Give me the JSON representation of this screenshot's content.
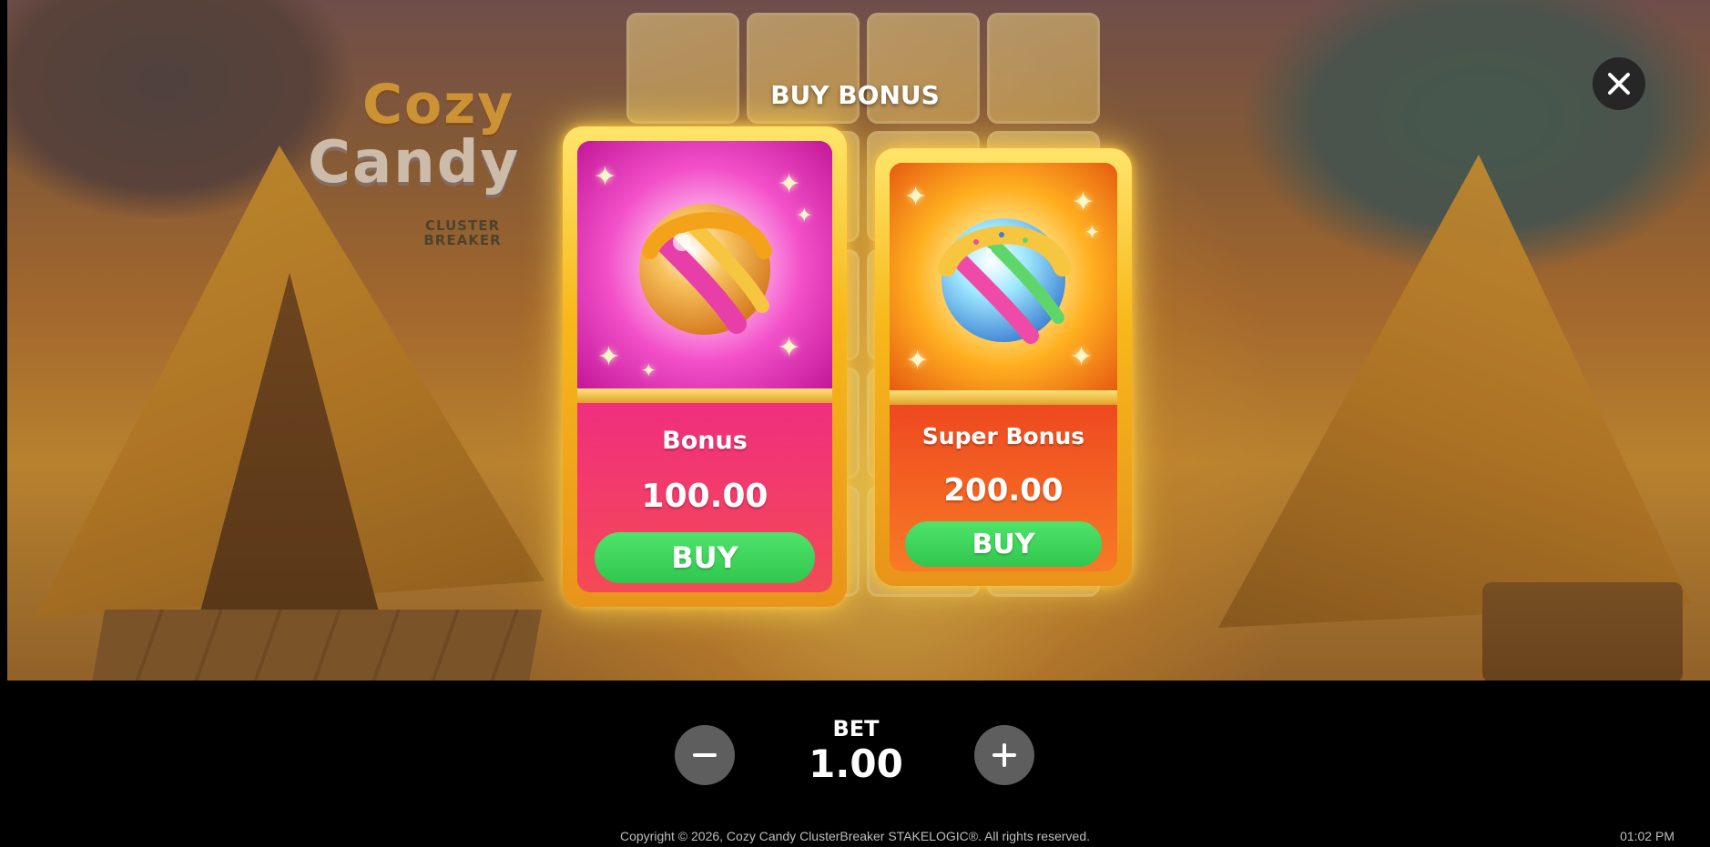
{
  "game": {
    "logo_line1": "Cozy",
    "logo_line2": "Candy",
    "logo_subtitle": "CLUSTER BREAKER"
  },
  "modal": {
    "title": "BUY BONUS",
    "close_icon": "close-icon",
    "cards": [
      {
        "name": "Bonus",
        "price": "100.00",
        "button_label": "BUY",
        "accent": "#e8217f",
        "art_icon": "candy-ball-icon"
      },
      {
        "name": "Super Bonus",
        "price": "200.00",
        "button_label": "BUY",
        "accent": "#e8301a",
        "art_icon": "super-candy-ball-icon"
      }
    ]
  },
  "bet": {
    "label": "BET",
    "value": "1.00",
    "decrease_icon": "minus-icon",
    "increase_icon": "plus-icon"
  },
  "footer": {
    "copyright": "Copyright © 2026, Cozy Candy ClusterBreaker STAKELOGIC®. All rights reserved.",
    "clock": "01:02 PM"
  },
  "colors": {
    "buy_button": "#3fd65b",
    "card_frame": "#f7b81a",
    "bar_background": "#000000"
  }
}
